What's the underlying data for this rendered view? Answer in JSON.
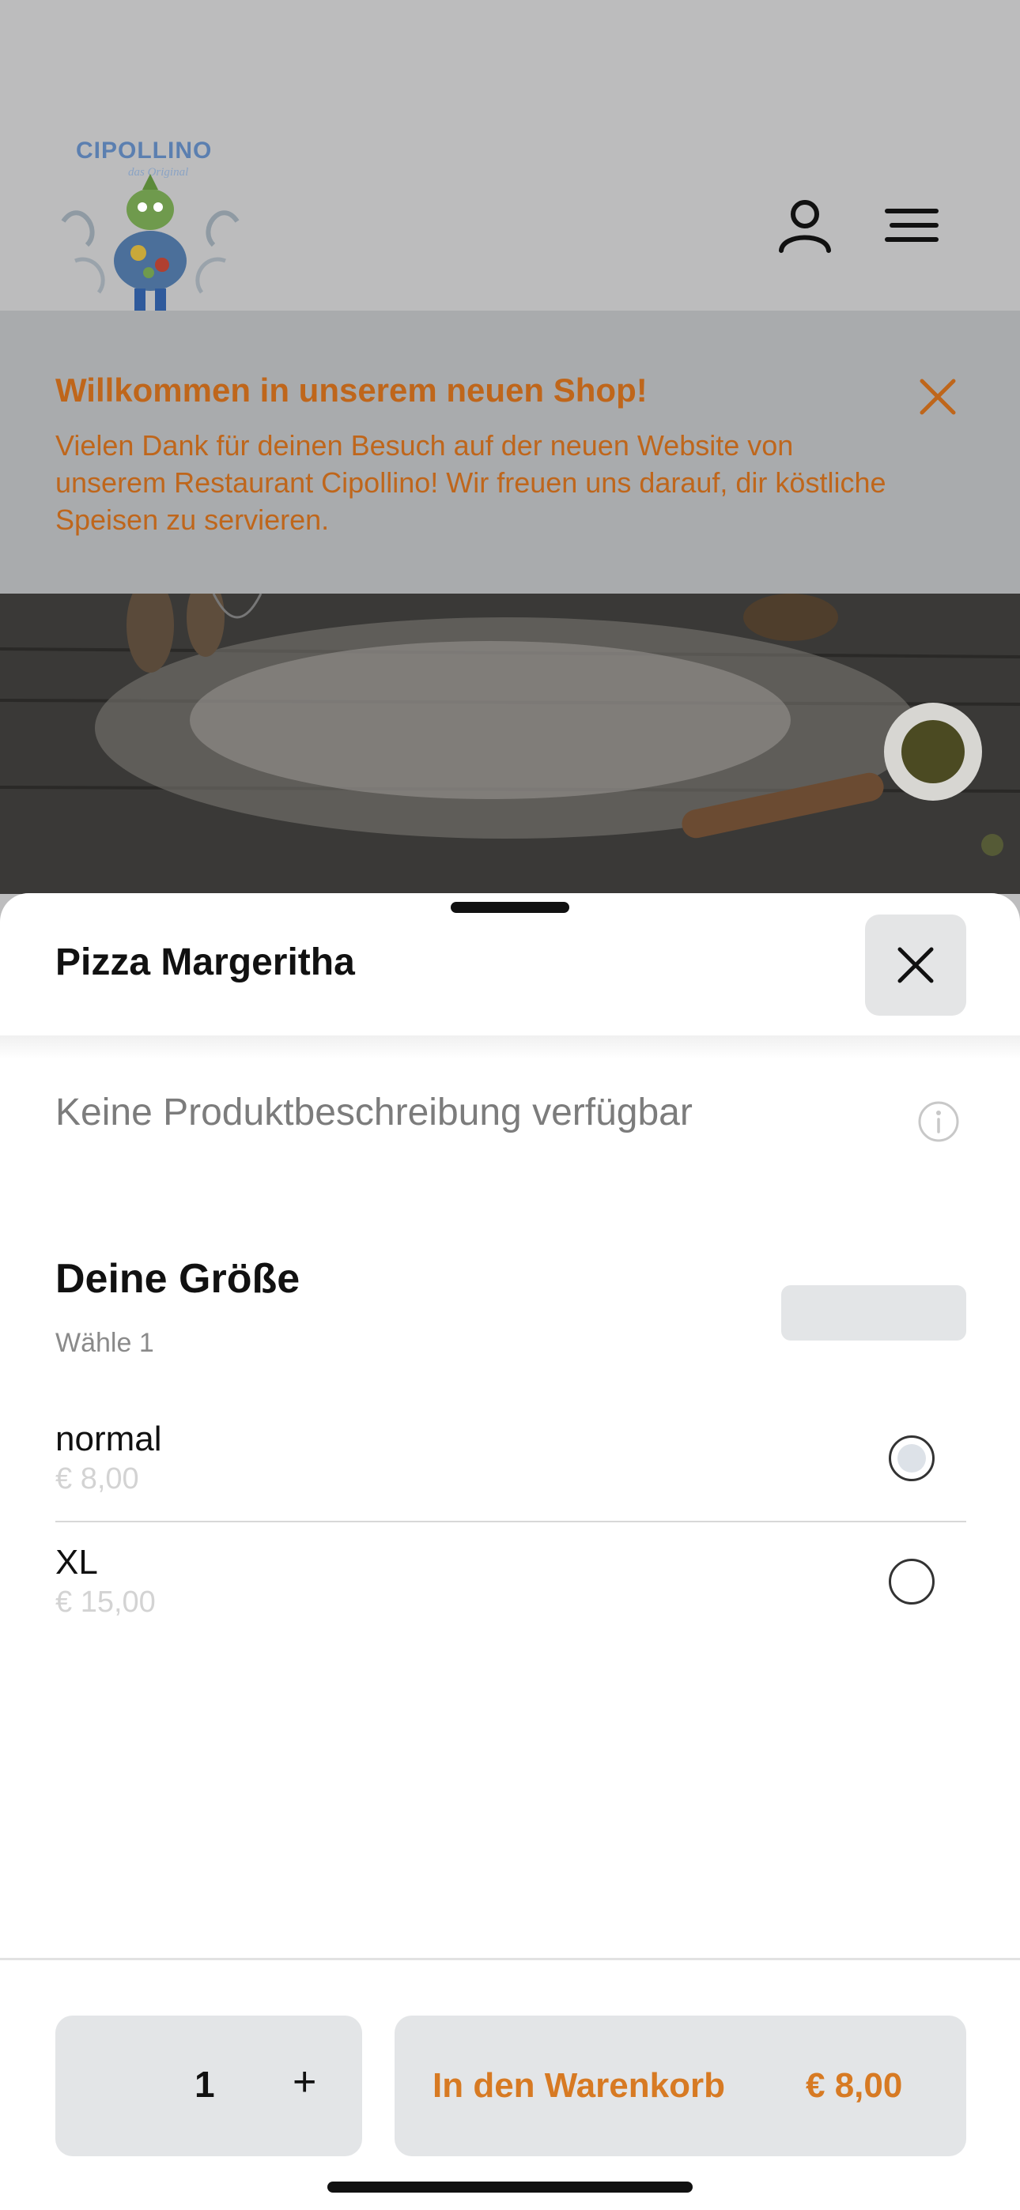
{
  "header": {
    "logo_text": "CIPOLLINO",
    "logo_subtext": "das Original",
    "user_icon": "user-icon",
    "menu_icon": "menu-icon"
  },
  "notice": {
    "title": "Willkommen in unserem neuen Shop!",
    "text": "Vielen Dank für deinen Besuch auf der neuen Website von unserem Restaurant Cipollino! Wir freuen uns darauf, dir köstliche Speisen zu servieren.",
    "accent_color": "#bf661b"
  },
  "sheet": {
    "title": "Pizza Margeritha",
    "description": "Keine Produktbeschreibung verfügbar",
    "group": {
      "title": "Deine Größe",
      "subtitle": "Wähle 1",
      "options": [
        {
          "name": "normal",
          "price": "€ 8,00",
          "selected": true
        },
        {
          "name": "XL",
          "price": "€ 15,00",
          "selected": false
        }
      ]
    }
  },
  "footer": {
    "quantity": "1",
    "plus": "+",
    "cart_label": "In den Warenkorb",
    "cart_price": "€ 8,00",
    "accent_color": "#d77a23"
  }
}
